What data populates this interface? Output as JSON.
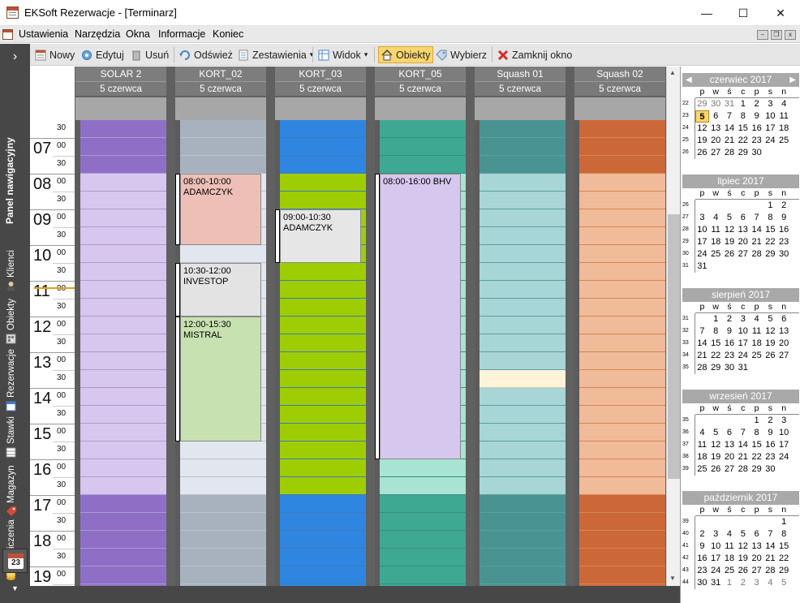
{
  "window": {
    "title": "EKSoft Rezerwacje - [Terminarz]",
    "minimize": "—",
    "maximize": "☐",
    "close": "✕"
  },
  "menu": {
    "items": [
      "Ustawienia",
      "Narzędzia",
      "Okna",
      "Informacje",
      "Koniec"
    ],
    "mdi": [
      "‒",
      "❐",
      "x"
    ]
  },
  "toolbar": {
    "new": "Nowy",
    "edit": "Edytuj",
    "delete": "Usuń",
    "refresh": "Odśwież",
    "reports": "Zestawienia",
    "view": "Widok",
    "objects": "Obiekty",
    "select": "Wybierz",
    "close": "Zamknij okno",
    "dropdown_glyph": "▾"
  },
  "nav": {
    "chevron": "›",
    "title": "Panel nawigacyjny",
    "items": [
      "Klienci",
      "Obiekty",
      "Rezerwacje",
      "Stawki",
      "Magazyn",
      "Rozliczenia"
    ],
    "calendar_day": "23",
    "down": "▼"
  },
  "timeline": {
    "top_partial_minute": "30",
    "hours": [
      "07",
      "08",
      "09",
      "10",
      "11",
      "12",
      "13",
      "14",
      "15",
      "16",
      "17",
      "18",
      "19"
    ],
    "minute_labels": [
      "00",
      "30"
    ]
  },
  "columns": [
    {
      "name": "SOLAR 2",
      "date": "5 czerwca",
      "color_dark": "#8f6fc6",
      "color_light": "#d7c7ee",
      "line": "#a99bd0"
    },
    {
      "name": "KORT_02",
      "date": "5 czerwca",
      "color_dark": "#a8b2bf",
      "color_light": "#e2e7ef",
      "line": "#b8c1cc"
    },
    {
      "name": "KORT_03",
      "date": "5 czerwca",
      "color_dark": "#2f86e0",
      "color_light": "#9ecd04",
      "line": "#3f7ab8"
    },
    {
      "name": "KORT_05",
      "date": "5 czerwca",
      "color_dark": "#3fa892",
      "color_light": "#a9e3d3",
      "line": "#3a8f7f"
    },
    {
      "name": "Squash 01",
      "date": "5 czerwca",
      "color_dark": "#4a9393",
      "color_light": "#a8d5d5",
      "line": "#5c9ea0"
    },
    {
      "name": "Squash 02",
      "date": "5 czerwca",
      "color_dark": "#cc6838",
      "color_light": "#f0bb98",
      "line": "#d28655"
    }
  ],
  "events": [
    {
      "column": 1,
      "time": "08:00-10:00",
      "title": "ADAMCZYK",
      "color": "#edbfb7"
    },
    {
      "column": 1,
      "time": "10:30-12:00",
      "title": "INVESTOP",
      "color": "#e3e3e3"
    },
    {
      "column": 1,
      "time": "12:00-15:30",
      "title": "MISTRAL",
      "color": "#c8e1b0"
    },
    {
      "column": 2,
      "time": "09:00-10:30",
      "title": "ADAMCZYK",
      "color": "#e6e6e6"
    },
    {
      "column": 3,
      "time": "08:00-16:00 BHV",
      "title": "",
      "color": "#d6c7ee"
    }
  ],
  "calendar": {
    "dow": [
      "p",
      "w",
      "ś",
      "c",
      "p",
      "s",
      "n"
    ],
    "prev": "◀",
    "next": "▶",
    "months": [
      {
        "title": "czerwiec 2017",
        "weeks": [
          {
            "wk": "22",
            "days": [
              "29",
              "30",
              "31",
              "1",
              "2",
              "3",
              "4"
            ]
          },
          {
            "wk": "23",
            "days": [
              "5",
              "6",
              "7",
              "8",
              "9",
              "10",
              "11"
            ]
          },
          {
            "wk": "24",
            "days": [
              "12",
              "13",
              "14",
              "15",
              "16",
              "17",
              "18"
            ]
          },
          {
            "wk": "25",
            "days": [
              "19",
              "20",
              "21",
              "22",
              "23",
              "24",
              "25"
            ]
          },
          {
            "wk": "26",
            "days": [
              "26",
              "27",
              "28",
              "29",
              "30",
              "",
              ""
            ]
          }
        ]
      },
      {
        "title": "lipiec 2017",
        "weeks": [
          {
            "wk": "26",
            "days": [
              "",
              "",
              "",
              "",
              "",
              "1",
              "2"
            ]
          },
          {
            "wk": "27",
            "days": [
              "3",
              "4",
              "5",
              "6",
              "7",
              "8",
              "9"
            ]
          },
          {
            "wk": "28",
            "days": [
              "10",
              "11",
              "12",
              "13",
              "14",
              "15",
              "16"
            ]
          },
          {
            "wk": "29",
            "days": [
              "17",
              "18",
              "19",
              "20",
              "21",
              "22",
              "23"
            ]
          },
          {
            "wk": "30",
            "days": [
              "24",
              "25",
              "26",
              "27",
              "28",
              "29",
              "30"
            ]
          },
          {
            "wk": "31",
            "days": [
              "31",
              "",
              "",
              "",
              "",
              "",
              ""
            ]
          }
        ]
      },
      {
        "title": "sierpień 2017",
        "weeks": [
          {
            "wk": "31",
            "days": [
              "",
              "1",
              "2",
              "3",
              "4",
              "5",
              "6"
            ]
          },
          {
            "wk": "32",
            "days": [
              "7",
              "8",
              "9",
              "10",
              "11",
              "12",
              "13"
            ]
          },
          {
            "wk": "33",
            "days": [
              "14",
              "15",
              "16",
              "17",
              "18",
              "19",
              "20"
            ]
          },
          {
            "wk": "34",
            "days": [
              "21",
              "22",
              "23",
              "24",
              "25",
              "26",
              "27"
            ]
          },
          {
            "wk": "35",
            "days": [
              "28",
              "29",
              "30",
              "31",
              "",
              "",
              ""
            ]
          }
        ]
      },
      {
        "title": "wrzesień 2017",
        "weeks": [
          {
            "wk": "35",
            "days": [
              "",
              "",
              "",
              "",
              "1",
              "2",
              "3"
            ]
          },
          {
            "wk": "36",
            "days": [
              "4",
              "5",
              "6",
              "7",
              "8",
              "9",
              "10"
            ]
          },
          {
            "wk": "37",
            "days": [
              "11",
              "12",
              "13",
              "14",
              "15",
              "16",
              "17"
            ]
          },
          {
            "wk": "38",
            "days": [
              "18",
              "19",
              "20",
              "21",
              "22",
              "23",
              "24"
            ]
          },
          {
            "wk": "39",
            "days": [
              "25",
              "26",
              "27",
              "28",
              "29",
              "30",
              ""
            ]
          }
        ]
      },
      {
        "title": "październik 2017",
        "weeks": [
          {
            "wk": "39",
            "days": [
              "",
              "",
              "",
              "",
              "",
              "",
              "1"
            ]
          },
          {
            "wk": "40",
            "days": [
              "2",
              "3",
              "4",
              "5",
              "6",
              "7",
              "8"
            ]
          },
          {
            "wk": "41",
            "days": [
              "9",
              "10",
              "11",
              "12",
              "13",
              "14",
              "15"
            ]
          },
          {
            "wk": "42",
            "days": [
              "16",
              "17",
              "18",
              "19",
              "20",
              "21",
              "22"
            ]
          },
          {
            "wk": "43",
            "days": [
              "23",
              "24",
              "25",
              "26",
              "27",
              "28",
              "29"
            ]
          },
          {
            "wk": "44",
            "days": [
              "30",
              "31",
              "1",
              "2",
              "3",
              "4",
              "5"
            ]
          }
        ]
      }
    ]
  }
}
